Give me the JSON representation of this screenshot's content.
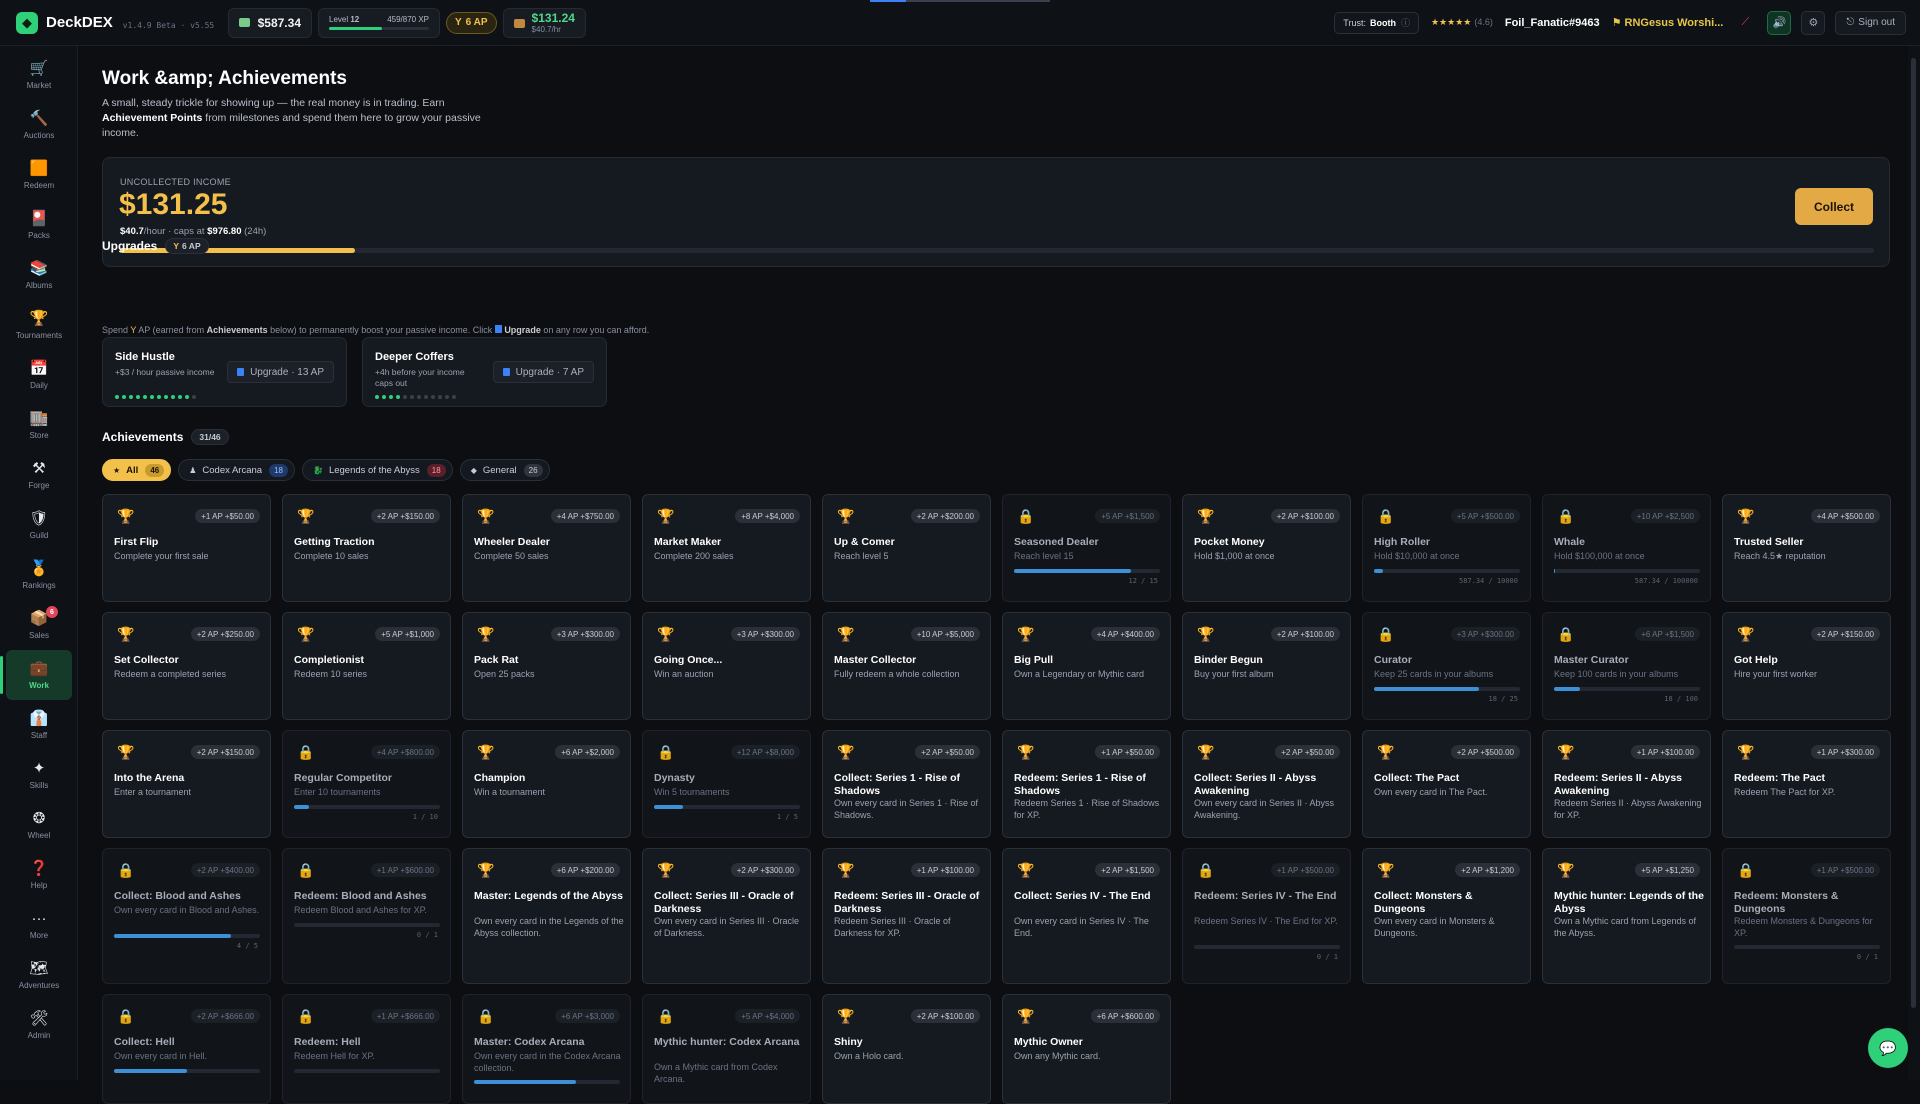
{
  "app": {
    "name": "DeckDEX",
    "version": "v1.4.9 Beta · v5.55"
  },
  "topbar": {
    "balance": "$587.34",
    "level_label": "Level",
    "level_num": "12",
    "xp_text": "459/870 XP",
    "xp_fraction": 0.53,
    "ap": "6 AP",
    "income_amount": "$131.24",
    "income_rate": "$40.7/hr",
    "trust_label": "Trust:",
    "trust_value": "Booth",
    "stars": "★★★★★",
    "rating": "(4.6)",
    "username": "Foil_Fanatic#9463",
    "guild": "RNGesus Worshi...",
    "signout": "Sign out"
  },
  "sidebar": [
    {
      "label": "Market",
      "icon": "🛒"
    },
    {
      "label": "Auctions",
      "icon": "🔨"
    },
    {
      "label": "Redeem",
      "icon": "🟧"
    },
    {
      "label": "Packs",
      "icon": "🎴"
    },
    {
      "label": "Albums",
      "icon": "📚"
    },
    {
      "label": "Tournaments",
      "icon": "🏆"
    },
    {
      "label": "Daily",
      "icon": "📅"
    },
    {
      "label": "Store",
      "icon": "🏬"
    },
    {
      "label": "Forge",
      "icon": "⚒"
    },
    {
      "label": "Guild",
      "icon": "🛡"
    },
    {
      "label": "Rankings",
      "icon": "🏅"
    },
    {
      "label": "Sales",
      "icon": "📦",
      "badge": "6"
    },
    {
      "label": "Work",
      "icon": "💼",
      "active": true
    },
    {
      "label": "Staff",
      "icon": "👔"
    },
    {
      "label": "Skills",
      "icon": "✦"
    },
    {
      "label": "Wheel",
      "icon": "❂"
    },
    {
      "label": "Help",
      "icon": "❓"
    },
    {
      "label": "More",
      "icon": "···"
    },
    {
      "label": "Adventures",
      "icon": "🗺"
    },
    {
      "label": "Admin",
      "icon": "🛠"
    }
  ],
  "page": {
    "title": "Work &amp; Achievements",
    "intro_1": "A small, steady trickle for showing up — the real money is in trading. Earn",
    "intro_bold": "Achievement Points",
    "intro_2": "from milestones and spend them here to grow your passive income."
  },
  "income": {
    "label": "UNCOLLECTED INCOME",
    "value": "$131.25",
    "rate": "$40.7",
    "rate_suffix": "/hour · caps at",
    "cap": "$976.80",
    "cap_window": "(24h)",
    "fraction": 0.134,
    "collect": "Collect"
  },
  "upgrades": {
    "title": "Upgrades",
    "ap": "6 AP",
    "note_1": "Spend",
    "note_2": "AP (earned from",
    "note_bold": "Achievements",
    "note_3": "below) to permanently boost your passive income. Click",
    "note_bold2": "Upgrade",
    "note_4": "on any row you can afford.",
    "items": [
      {
        "title": "Side Hustle",
        "desc": "+$3 / hour passive income",
        "button": "Upgrade · 13 AP",
        "level": 11,
        "max": 12
      },
      {
        "title": "Deeper Coffers",
        "desc": "+4h before your income caps out",
        "button": "Upgrade · 7 AP",
        "level": 4,
        "max": 12
      }
    ]
  },
  "achievements": {
    "title": "Achievements",
    "count": "31/46",
    "filters": [
      {
        "label": "All",
        "count": "46",
        "style": "all",
        "icon": "★"
      },
      {
        "label": "Codex Arcana",
        "count": "18",
        "style": "blue",
        "icon": "♟"
      },
      {
        "label": "Legends of the Abyss",
        "count": "18",
        "style": "red",
        "icon": "🐉"
      },
      {
        "label": "General",
        "count": "26",
        "style": "gray",
        "icon": "◆"
      }
    ],
    "items": [
      {
        "name": "First Flip",
        "desc": "Complete your first sale",
        "reward": "+1 AP +$50.00",
        "locked": false
      },
      {
        "name": "Getting Traction",
        "desc": "Complete 10 sales",
        "reward": "+2 AP +$150.00",
        "locked": false
      },
      {
        "name": "Wheeler Dealer",
        "desc": "Complete 50 sales",
        "reward": "+4 AP +$750.00",
        "locked": false
      },
      {
        "name": "Market Maker",
        "desc": "Complete 200 sales",
        "reward": "+8 AP +$4,000",
        "locked": false
      },
      {
        "name": "Up & Comer",
        "desc": "Reach level 5",
        "reward": "+2 AP +$200.00",
        "locked": false
      },
      {
        "name": "Seasoned Dealer",
        "desc": "Reach level 15",
        "reward": "+5 AP +$1,500",
        "locked": true,
        "progress": 0.8,
        "progress_text": "12 / 15"
      },
      {
        "name": "Pocket Money",
        "desc": "Hold $1,000 at once",
        "reward": "+2 AP +$100.00",
        "locked": false
      },
      {
        "name": "High Roller",
        "desc": "Hold $10,000 at once",
        "reward": "+5 AP +$500.00",
        "locked": true,
        "progress": 0.06,
        "progress_text": "587.34 / 10000"
      },
      {
        "name": "Whale",
        "desc": "Hold $100,000 at once",
        "reward": "+10 AP +$2,500",
        "locked": true,
        "progress": 0.006,
        "progress_text": "587.34 / 100000"
      },
      {
        "name": "Trusted Seller",
        "desc": "Reach 4.5★ reputation",
        "reward": "+4 AP +$500.00",
        "locked": false
      },
      {
        "name": "Set Collector",
        "desc": "Redeem a completed series",
        "reward": "+2 AP +$250.00",
        "locked": false
      },
      {
        "name": "Completionist",
        "desc": "Redeem 10 series",
        "reward": "+5 AP +$1,000",
        "locked": false
      },
      {
        "name": "Pack Rat",
        "desc": "Open 25 packs",
        "reward": "+3 AP +$300.00",
        "locked": false
      },
      {
        "name": "Going Once...",
        "desc": "Win an auction",
        "reward": "+3 AP +$300.00",
        "locked": false
      },
      {
        "name": "Master Collector",
        "desc": "Fully redeem a whole collection",
        "reward": "+10 AP +$5,000",
        "locked": false
      },
      {
        "name": "Big Pull",
        "desc": "Own a Legendary or Mythic card",
        "reward": "+4 AP +$400.00",
        "locked": false
      },
      {
        "name": "Binder Begun",
        "desc": "Buy your first album",
        "reward": "+2 AP +$100.00",
        "locked": false
      },
      {
        "name": "Curator",
        "desc": "Keep 25 cards in your albums",
        "reward": "+3 AP +$300.00",
        "locked": true,
        "progress": 0.72,
        "progress_text": "18 / 25"
      },
      {
        "name": "Master Curator",
        "desc": "Keep 100 cards in your albums",
        "reward": "+6 AP +$1,500",
        "locked": true,
        "progress": 0.18,
        "progress_text": "18 / 100"
      },
      {
        "name": "Got Help",
        "desc": "Hire your first worker",
        "reward": "+2 AP +$150.00",
        "locked": false
      },
      {
        "name": "Into the Arena",
        "desc": "Enter a tournament",
        "reward": "+2 AP +$150.00",
        "locked": false
      },
      {
        "name": "Regular Competitor",
        "desc": "Enter 10 tournaments",
        "reward": "+4 AP +$800.00",
        "locked": true,
        "progress": 0.1,
        "progress_text": "1 / 10"
      },
      {
        "name": "Champion",
        "desc": "Win a tournament",
        "reward": "+6 AP +$2,000",
        "locked": false
      },
      {
        "name": "Dynasty",
        "desc": "Win 5 tournaments",
        "reward": "+12 AP +$8,000",
        "locked": true,
        "progress": 0.2,
        "progress_text": "1 / 5"
      },
      {
        "name": "Collect: Series 1 - Rise of Shadows",
        "desc": "Own every card in Series 1 · Rise of Shadows.",
        "reward": "+2 AP +$50.00",
        "locked": false
      },
      {
        "name": "Redeem: Series 1 - Rise of Shadows",
        "desc": "Redeem Series 1 · Rise of Shadows for XP.",
        "reward": "+1 AP +$50.00",
        "locked": false
      },
      {
        "name": "Collect: Series II - Abyss Awakening",
        "desc": "Own every card in Series II · Abyss Awakening.",
        "reward": "+2 AP +$50.00",
        "locked": false
      },
      {
        "name": "Collect: The Pact",
        "desc": "Own every card in The Pact.",
        "reward": "+2 AP +$500.00",
        "locked": false
      },
      {
        "name": "Redeem: Series II - Abyss Awakening",
        "desc": "Redeem Series II · Abyss Awakening for XP.",
        "reward": "+1 AP +$100.00",
        "locked": false
      },
      {
        "name": "Redeem: The Pact",
        "desc": "Redeem The Pact for XP.",
        "reward": "+1 AP +$300.00",
        "locked": false
      },
      {
        "name": "Collect: Blood and Ashes",
        "desc": "Own every card in Blood and Ashes.",
        "reward": "+2 AP +$400.00",
        "locked": true,
        "progress": 0.8,
        "progress_text": "4 / 5"
      },
      {
        "name": "Redeem: Blood and Ashes",
        "desc": "Redeem Blood and Ashes for XP.",
        "reward": "+1 AP +$600.00",
        "locked": true,
        "progress": 0,
        "progress_text": "0 / 1"
      },
      {
        "name": "Master: Legends of the Abyss",
        "desc": "Own every card in the Legends of the Abyss collection.",
        "reward": "+6 AP +$200.00",
        "locked": false
      },
      {
        "name": "Collect: Series III - Oracle of Darkness",
        "desc": "Own every card in Series III · Oracle of Darkness.",
        "reward": "+2 AP +$300.00",
        "locked": false
      },
      {
        "name": "Redeem: Series III - Oracle of Darkness",
        "desc": "Redeem Series III · Oracle of Darkness for XP.",
        "reward": "+1 AP +$100.00",
        "locked": false
      },
      {
        "name": "Collect: Series IV - The End",
        "desc": "Own every card in Series IV · The End.",
        "reward": "+2 AP +$1,500",
        "locked": false
      },
      {
        "name": "Redeem: Series IV - The End",
        "desc": "Redeem Series IV · The End for XP.",
        "reward": "+1 AP +$500.00",
        "locked": true,
        "progress": 0,
        "progress_text": "0 / 1"
      },
      {
        "name": "Collect: Monsters & Dungeons",
        "desc": "Own every card in Monsters & Dungeons.",
        "reward": "+2 AP +$1,200",
        "locked": false
      },
      {
        "name": "Mythic hunter: Legends of the Abyss",
        "desc": "Own a Mythic card from Legends of the Abyss.",
        "reward": "+5 AP +$1,250",
        "locked": false
      },
      {
        "name": "Redeem: Monsters & Dungeons",
        "desc": "Redeem Monsters & Dungeons for XP.",
        "reward": "+1 AP +$500.00",
        "locked": true,
        "progress": 0,
        "progress_text": "0 / 1"
      },
      {
        "name": "Collect: Hell",
        "desc": "Own every card in Hell.",
        "reward": "+2 AP +$666.00",
        "locked": true,
        "progress": 0.5,
        "progress_text": ""
      },
      {
        "name": "Redeem: Hell",
        "desc": "Redeem Hell for XP.",
        "reward": "+1 AP +$666.00",
        "locked": true,
        "progress": 0,
        "progress_text": ""
      },
      {
        "name": "Master: Codex Arcana",
        "desc": "Own every card in the Codex Arcana collection.",
        "reward": "+6 AP +$3,000",
        "locked": true,
        "progress": 0.7,
        "progress_text": ""
      },
      {
        "name": "Mythic hunter: Codex Arcana",
        "desc": "Own a Mythic card from Codex Arcana.",
        "reward": "+5 AP +$4,000",
        "locked": true
      },
      {
        "name": "Shiny",
        "desc": "Own a Holo card.",
        "reward": "+2 AP +$100.00",
        "locked": false
      },
      {
        "name": "Mythic Owner",
        "desc": "Own any Mythic card.",
        "reward": "+6 AP +$600.00",
        "locked": false
      }
    ]
  }
}
